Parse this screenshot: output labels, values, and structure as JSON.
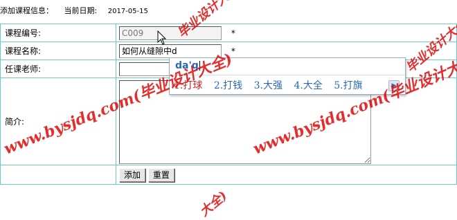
{
  "header": {
    "title": "添加课程信息：",
    "date_label": "当前日期:",
    "date_value": "2017-05-15"
  },
  "form": {
    "course_code": {
      "label": "课程编号:",
      "value": "C009",
      "required_mark": "*"
    },
    "course_name": {
      "label": "课程名称:",
      "value": "如何从缝隙中d",
      "required_mark": "*"
    },
    "teacher": {
      "label": "任课老师:",
      "value": ""
    },
    "intro": {
      "label": "简介:",
      "value": ""
    },
    "buttons": {
      "add": "添加",
      "reset": "重置"
    }
  },
  "ime": {
    "composition": "da'q",
    "candidates": [
      "1.打球",
      "2.打钱",
      "3.大强",
      "4.大全",
      "5.打旗"
    ],
    "next_icon": "chevron-right-icon"
  },
  "watermarks": {
    "primary": "www.bysjdq.com(毕业设计大全)",
    "partial_top": "毕业设计大全)",
    "partial_bottom": "大全)"
  },
  "colors": {
    "border": "#66cccc",
    "watermark": "#e00000",
    "ime_text": "#2a66b8",
    "ime_selected": "#d02020"
  }
}
